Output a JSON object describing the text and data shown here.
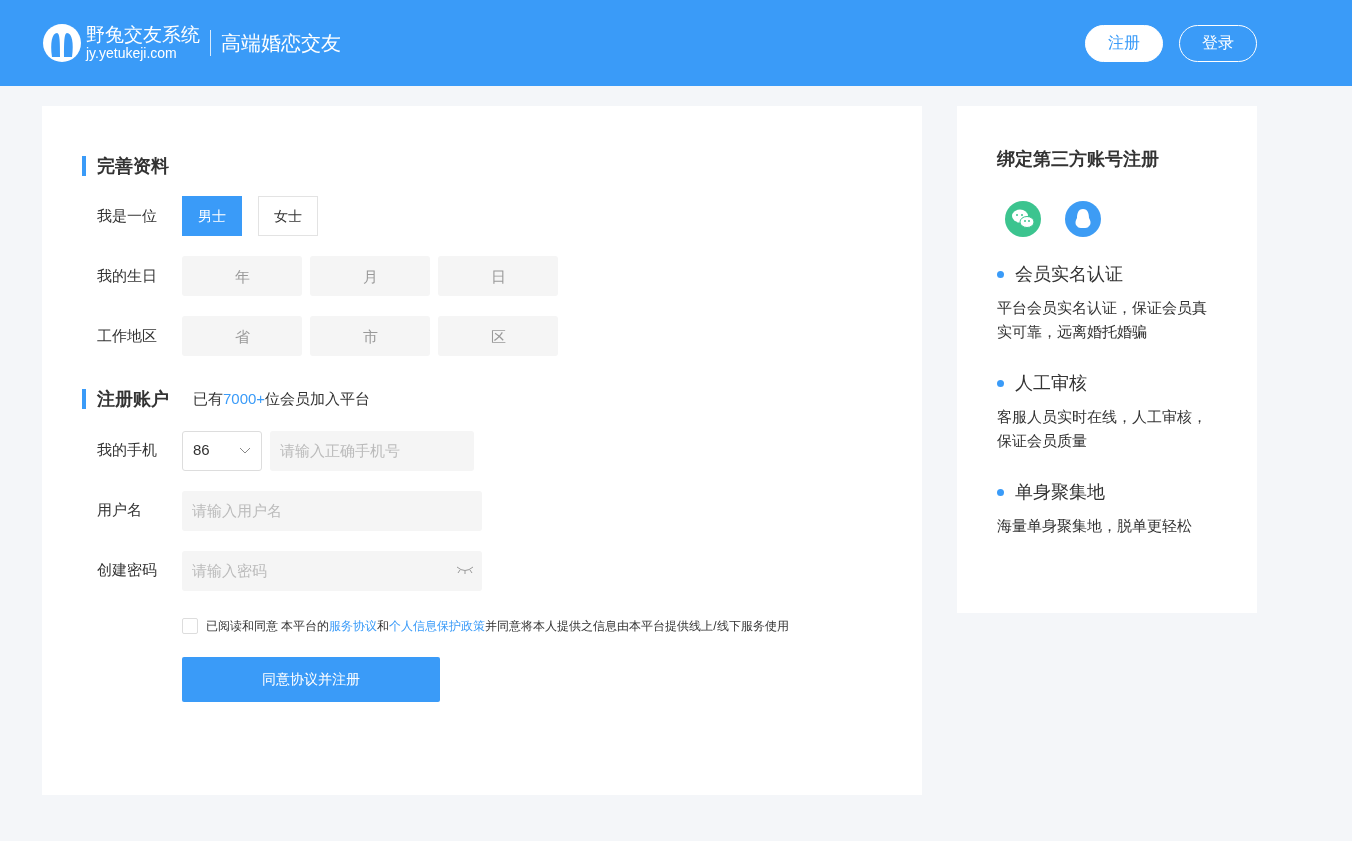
{
  "header": {
    "logo_name": "野兔交友系统",
    "logo_url": "jy.yetukeji.com",
    "slogan": "高端婚恋交友",
    "buttons": [
      {
        "label": "注册",
        "kind": "filled"
      },
      {
        "label": "登录",
        "kind": "outline"
      }
    ]
  },
  "profile": {
    "title": "完善资料",
    "rows": [
      {
        "label": "我是一位",
        "kind": "choice",
        "options": [
          {
            "label": "男士",
            "selected": true
          },
          {
            "label": "女士",
            "selected": false
          }
        ]
      },
      {
        "label": "我的生日",
        "kind": "triple",
        "placeholders": [
          "年",
          "月",
          "日"
        ]
      },
      {
        "label": "工作地区",
        "kind": "triple",
        "placeholders": [
          "省",
          "市",
          "区"
        ]
      }
    ]
  },
  "account": {
    "title": "注册账户",
    "note": "已有**7000+**位会员加入平台",
    "rows": [
      {
        "label": "我的手机",
        "kind": "phone",
        "code": "86",
        "placeholder": "请输入正确手机号"
      },
      {
        "label": "用户名",
        "kind": "text",
        "placeholder": "请输入用户名"
      },
      {
        "label": "创建密码",
        "kind": "password",
        "placeholder": "请输入密码"
      }
    ],
    "agreement": {
      "checked": false,
      "parts": [
        {
          "kind": "text",
          "text": "已阅读和同意 本平台的"
        },
        {
          "kind": "link",
          "text": "服务协议"
        },
        {
          "kind": "text",
          "text": "和"
        },
        {
          "kind": "link",
          "text": "个人信息保护政策"
        },
        {
          "kind": "text",
          "text": "并同意将本人提供之信息由本平台提供线上/线下服务使用"
        }
      ]
    },
    "submit": "同意协议并注册"
  },
  "sidebar": {
    "title": "绑定第三方账号注册",
    "logins": [
      {
        "kind": "wechat"
      },
      {
        "kind": "qq"
      }
    ],
    "features": [
      {
        "title": "会员实名认证",
        "text": "平台会员实名认证，保证会员真实可靠，远离婚托婚骗"
      },
      {
        "title": "人工审核",
        "text": "客服人员实时在线，人工审核，保证会员质量"
      },
      {
        "title": "单身聚集地",
        "text": "海量单身聚集地，脱单更轻松"
      }
    ]
  }
}
